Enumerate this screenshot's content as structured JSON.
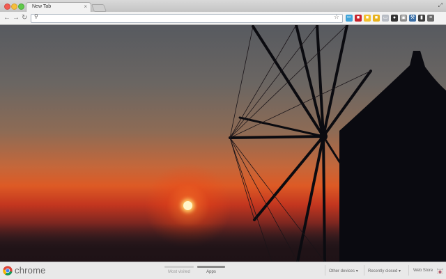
{
  "browser": {
    "tab": {
      "title": "New Tab",
      "close": "×"
    },
    "fullscreen_icon": "⤢"
  },
  "toolbar": {
    "back": "←",
    "forward": "→",
    "reload": "↻",
    "omnibox_value": "",
    "search_icon": "⚲",
    "star_icon": "☆",
    "extensions": [
      {
        "name": "scissors",
        "color": "#3fa3d8",
        "glyph": "✂"
      },
      {
        "name": "red-square",
        "color": "#c8232c",
        "glyph": "■"
      },
      {
        "name": "yellow-note",
        "color": "#f2c12e",
        "glyph": "■"
      },
      {
        "name": "yellow-note-2",
        "color": "#e7b21f",
        "glyph": "■"
      },
      {
        "name": "gray-chat",
        "color": "#b7bcc4",
        "glyph": "▭"
      },
      {
        "name": "dark-circle",
        "color": "#333333",
        "glyph": "●"
      },
      {
        "name": "box",
        "color": "#8c8c8c",
        "glyph": "▣"
      },
      {
        "name": "wrench",
        "color": "#3a6ea5",
        "glyph": "⚒"
      },
      {
        "name": "dark-card",
        "color": "#3c3c3c",
        "glyph": "▮"
      },
      {
        "name": "menu",
        "color": "#6b6b6b",
        "glyph": "≡"
      }
    ]
  },
  "bottom": {
    "brand": "chrome",
    "sections": [
      {
        "label": "Most visited",
        "active": false
      },
      {
        "label": "Apps",
        "active": true
      }
    ],
    "links": {
      "other_devices": "Other devices",
      "recently_closed": "Recently closed",
      "web_store": "Web Store"
    }
  }
}
